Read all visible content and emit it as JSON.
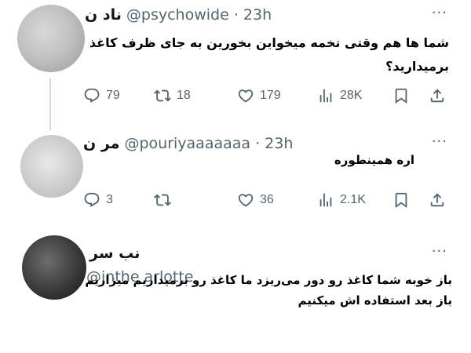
{
  "tweets": [
    {
      "name": "ناد ن",
      "handle": "@psychowide",
      "time": "· 23h",
      "more": "···",
      "text": "شما ها هم وقتی تخمه میخواین بخورین به جای ظرف کاغذ برمیدارید؟",
      "stats": {
        "replies": "79",
        "retweets": "18",
        "likes": "179",
        "views": "28K"
      }
    },
    {
      "name": "مر ن",
      "handle": "@pouriyaaaaaaa",
      "time": "· 23h",
      "more": "···",
      "text": "اره همینطوره",
      "stats": {
        "replies": "3",
        "retweets": "",
        "likes": "36",
        "views": "2.1K"
      }
    },
    {
      "name": "نب سر",
      "handle": "@inthe    arlotte",
      "time": "",
      "more": "···",
      "text": "باز خوبه شما کاغذ رو دور می‌ریزد ما کاغذ رو برمیداریم میزاریم باز بعد استفاده اش میکنیم"
    }
  ],
  "icons": {
    "reply": "reply-icon",
    "retweet": "retweet-icon",
    "like": "heart-icon",
    "views": "views-icon",
    "bookmark": "bookmark-icon",
    "share": "share-icon",
    "more": "more-icon"
  }
}
